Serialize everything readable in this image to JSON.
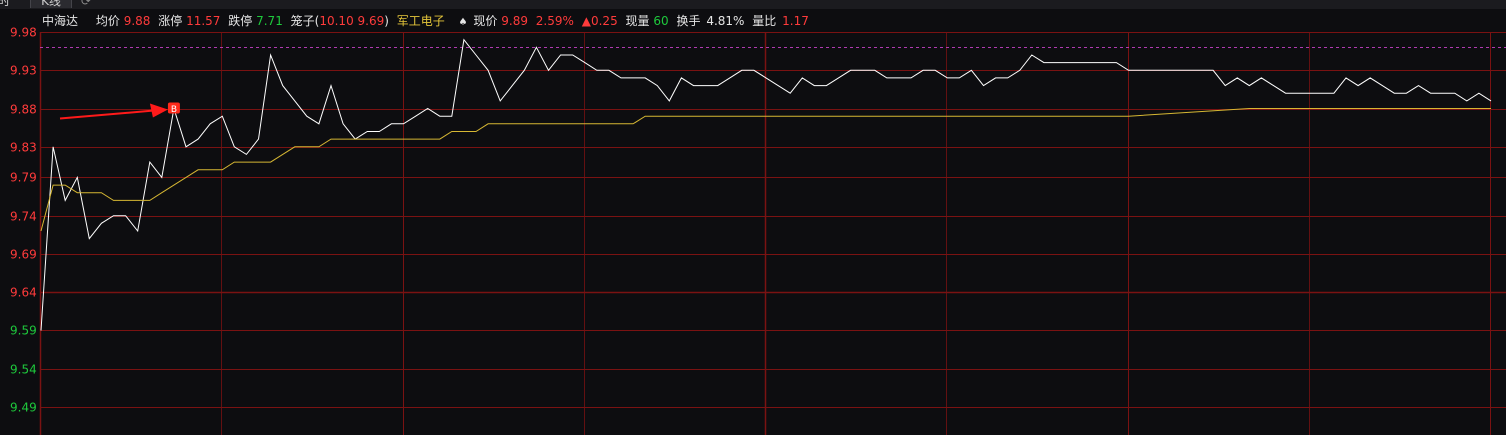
{
  "tabs": {
    "intraday": "时",
    "kline": "K线",
    "refresh_icon": "refresh-icon"
  },
  "info": {
    "name": "中海达",
    "avg_label": "均价",
    "avg_value": "9.88",
    "limit_up_label": "涨停",
    "limit_up_value": "11.57",
    "limit_down_label": "跌停",
    "limit_down_value": "7.71",
    "cage_label": "笼子(",
    "cage_high": "10.10",
    "cage_low": "9.69",
    "cage_close": ")",
    "sector": "军工电子",
    "price_label": "现价",
    "price_value": "9.89",
    "change_pct": "2.59%",
    "change_abs": "▲0.25",
    "volume_label": "现量",
    "volume_value": "60",
    "turnover_label": "换手",
    "turnover_value": "4.81%",
    "ratio_label": "量比",
    "ratio_value": "1.17"
  },
  "marker": {
    "text": "B"
  },
  "colors": {
    "background": "#0d0d10",
    "grid": "#7a1212",
    "price_line": "#ffffff",
    "avg_line": "#d6b733",
    "up_text": "#ff3b3b",
    "down_text": "#1ec93c",
    "limit_dash": "#b03ab0",
    "arrow": "#ff1a1a"
  },
  "chart_data": {
    "type": "line",
    "y_ticks": [
      {
        "label": "9.98",
        "value": 9.98,
        "side": "up"
      },
      {
        "label": "9.93",
        "value": 9.93,
        "side": "up"
      },
      {
        "label": "9.88",
        "value": 9.88,
        "side": "up"
      },
      {
        "label": "9.83",
        "value": 9.83,
        "side": "up"
      },
      {
        "label": "9.79",
        "value": 9.79,
        "side": "up"
      },
      {
        "label": "9.74",
        "value": 9.74,
        "side": "up"
      },
      {
        "label": "9.69",
        "value": 9.69,
        "side": "up"
      },
      {
        "label": "9.64",
        "value": 9.64,
        "side": "ref"
      },
      {
        "label": "9.59",
        "value": 9.59,
        "side": "down"
      },
      {
        "label": "9.54",
        "value": 9.54,
        "side": "down"
      },
      {
        "label": "9.49",
        "value": 9.49,
        "side": "down"
      }
    ],
    "ylim": [
      9.49,
      9.98
    ],
    "x_count": 241,
    "reference_price": 9.64,
    "dashed_level": 9.96,
    "series": [
      {
        "key": "price",
        "x": [
          0,
          2,
          4,
          6,
          8,
          10,
          12,
          14,
          16,
          18,
          20,
          22,
          24,
          26,
          28,
          30,
          32,
          34,
          36,
          38,
          40,
          42,
          44,
          46,
          48,
          50,
          52,
          54,
          56,
          58,
          60,
          62,
          64,
          66,
          68,
          70,
          72,
          74,
          76,
          78,
          80,
          82,
          84,
          86,
          88,
          90,
          92,
          94,
          96,
          98,
          100,
          102,
          104,
          106,
          108,
          110,
          112,
          114,
          116,
          118,
          120,
          122,
          124,
          126,
          128,
          130,
          132,
          134,
          136,
          138,
          140,
          142,
          144,
          146,
          148,
          150,
          152,
          154,
          156,
          158,
          160,
          162,
          164,
          166,
          168,
          170,
          172,
          174,
          176,
          178,
          180,
          182,
          184,
          186,
          188,
          190,
          192,
          194,
          196,
          198,
          200,
          202,
          204,
          206,
          208,
          210,
          212,
          214,
          216,
          218,
          220,
          222,
          224,
          226,
          228,
          230,
          232,
          234,
          236,
          238,
          240
        ],
        "values": [
          9.59,
          9.83,
          9.76,
          9.79,
          9.71,
          9.73,
          9.74,
          9.74,
          9.72,
          9.81,
          9.79,
          9.88,
          9.83,
          9.84,
          9.86,
          9.87,
          9.83,
          9.82,
          9.84,
          9.95,
          9.91,
          9.89,
          9.87,
          9.86,
          9.91,
          9.86,
          9.84,
          9.85,
          9.85,
          9.86,
          9.86,
          9.87,
          9.88,
          9.87,
          9.87,
          9.97,
          9.95,
          9.93,
          9.89,
          9.91,
          9.93,
          9.96,
          9.93,
          9.95,
          9.95,
          9.94,
          9.93,
          9.93,
          9.92,
          9.92,
          9.92,
          9.91,
          9.89,
          9.92,
          9.91,
          9.91,
          9.91,
          9.92,
          9.93,
          9.93,
          9.92,
          9.91,
          9.9,
          9.92,
          9.91,
          9.91,
          9.92,
          9.93,
          9.93,
          9.93,
          9.92,
          9.92,
          9.92,
          9.93,
          9.93,
          9.92,
          9.92,
          9.93,
          9.91,
          9.92,
          9.92,
          9.93,
          9.95,
          9.94,
          9.94,
          9.94,
          9.94,
          9.94,
          9.94,
          9.94,
          9.93,
          9.93,
          9.93,
          9.93,
          9.93,
          9.93,
          9.93,
          9.93,
          9.91,
          9.92,
          9.91,
          9.92,
          9.91,
          9.9,
          9.9,
          9.9,
          9.9,
          9.9,
          9.92,
          9.91,
          9.92,
          9.91,
          9.9,
          9.9,
          9.91,
          9.9,
          9.9,
          9.9,
          9.89,
          9.9,
          9.89
        ]
      },
      {
        "key": "avg",
        "x": [
          0,
          2,
          4,
          6,
          8,
          10,
          12,
          14,
          16,
          18,
          20,
          22,
          24,
          26,
          28,
          30,
          32,
          34,
          36,
          38,
          40,
          42,
          44,
          46,
          48,
          50,
          52,
          54,
          56,
          58,
          60,
          62,
          64,
          66,
          68,
          70,
          72,
          74,
          76,
          78,
          80,
          82,
          84,
          86,
          88,
          90,
          92,
          94,
          96,
          98,
          100,
          120,
          140,
          160,
          180,
          200,
          220,
          240
        ],
        "values": [
          9.72,
          9.78,
          9.78,
          9.77,
          9.77,
          9.77,
          9.76,
          9.76,
          9.76,
          9.76,
          9.77,
          9.78,
          9.79,
          9.8,
          9.8,
          9.8,
          9.81,
          9.81,
          9.81,
          9.81,
          9.82,
          9.83,
          9.83,
          9.83,
          9.84,
          9.84,
          9.84,
          9.84,
          9.84,
          9.84,
          9.84,
          9.84,
          9.84,
          9.84,
          9.85,
          9.85,
          9.85,
          9.86,
          9.86,
          9.86,
          9.86,
          9.86,
          9.86,
          9.86,
          9.86,
          9.86,
          9.86,
          9.86,
          9.86,
          9.86,
          9.87,
          9.87,
          9.87,
          9.87,
          9.87,
          9.88,
          9.88,
          9.88
        ]
      }
    ],
    "annotations": [
      {
        "type": "buy-marker",
        "label": "B",
        "x": 22,
        "y": 9.88
      }
    ]
  }
}
